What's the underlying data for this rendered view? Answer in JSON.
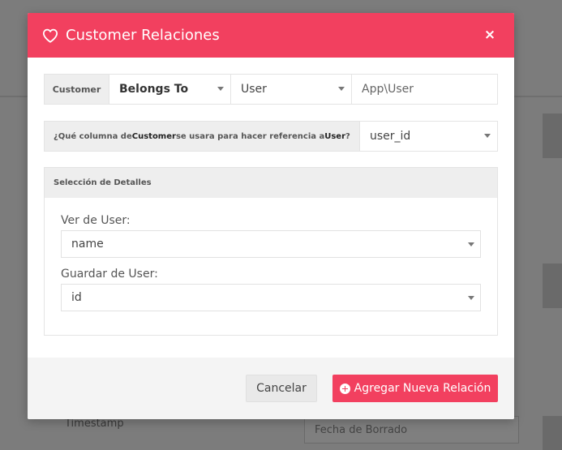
{
  "background": {
    "timestamp_label": "Timestamp",
    "input_placeholder": "Fecha de Borrado"
  },
  "modal": {
    "title": "Customer Relaciones",
    "close_symbol": "×",
    "accent_color": "#f2405f",
    "relation": {
      "model_label": "Customer",
      "type_value": "Belongs To",
      "target_value": "User",
      "namespace_value": "App\\User"
    },
    "foreign_key": {
      "label_prefix": "¿Qué columna de ",
      "label_model": "Customer",
      "label_middle": " se usara para hacer referencia a ",
      "label_target": "User",
      "label_suffix": "?",
      "value": "user_id"
    },
    "details": {
      "heading": "Selección de Detalles",
      "view_label": "Ver de User:",
      "view_value": "name",
      "store_label": "Guardar de User:",
      "store_value": "id"
    },
    "footer": {
      "cancel_label": "Cancelar",
      "add_label": "Agregar Nueva Relación"
    }
  }
}
